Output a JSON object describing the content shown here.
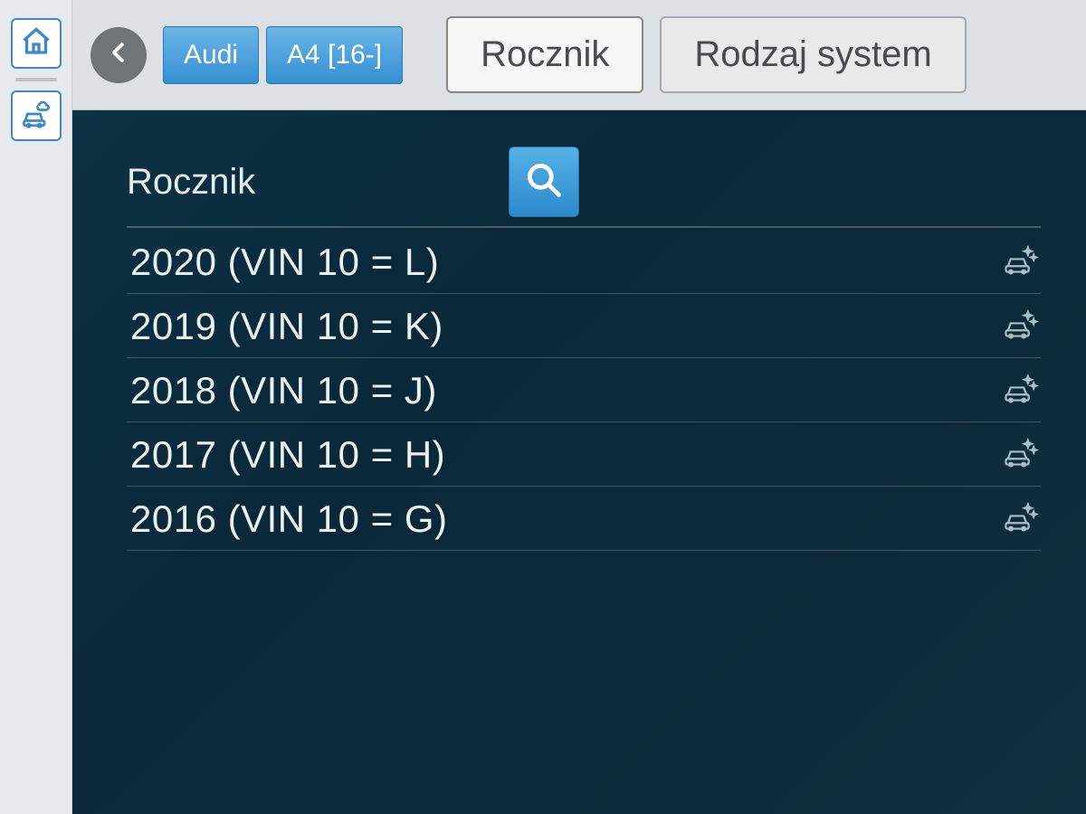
{
  "sidebar": {
    "home_icon": "home",
    "diag_icon": "diagnostics"
  },
  "breadcrumb": {
    "make": "Audi",
    "model": "A4 [16-]"
  },
  "tabs": {
    "active": "Rocznik",
    "next": "Rodzaj system"
  },
  "section": {
    "title": "Rocznik"
  },
  "rows": [
    {
      "label": "2020 (VIN 10 = L)"
    },
    {
      "label": "2019 (VIN 10 = K)"
    },
    {
      "label": "2018 (VIN 10 = J)"
    },
    {
      "label": "2017 (VIN 10 = H)"
    },
    {
      "label": "2016 (VIN 10 = G)"
    }
  ]
}
